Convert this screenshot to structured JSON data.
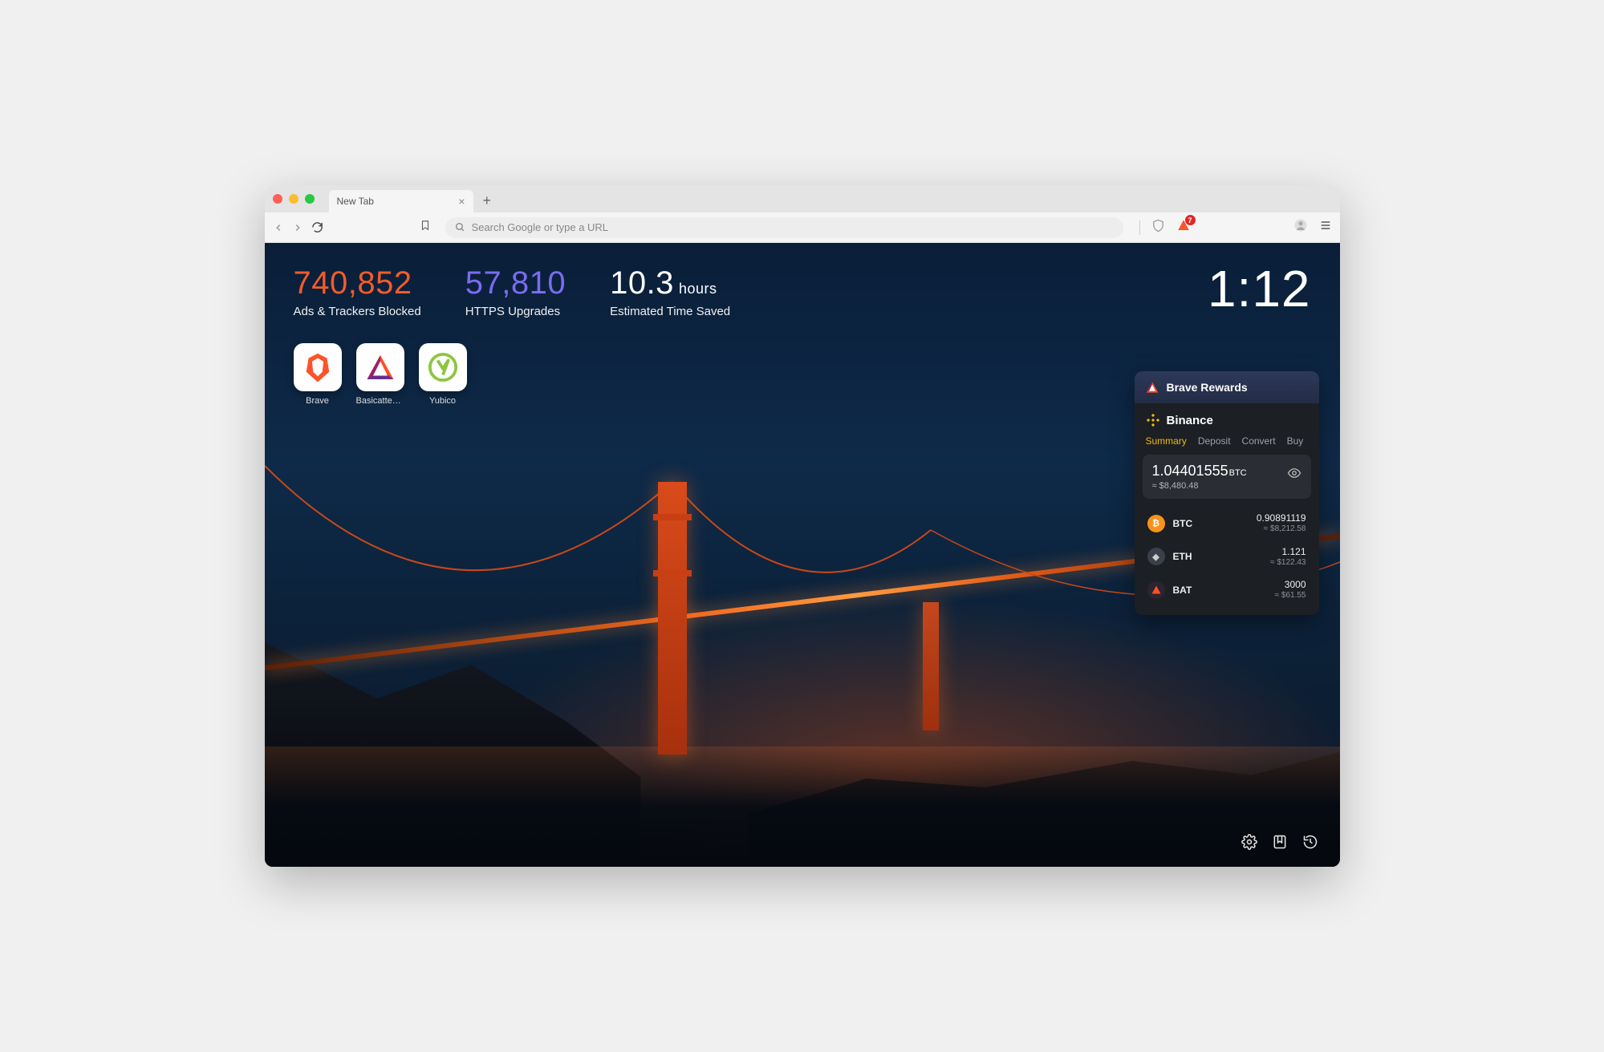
{
  "tab": {
    "title": "New Tab"
  },
  "omnibox": {
    "placeholder": "Search Google or type a URL"
  },
  "toolbar": {
    "ext_badge": "7"
  },
  "stats": {
    "blocked": {
      "value": "740,852",
      "label": "Ads & Trackers Blocked"
    },
    "https": {
      "value": "57,810",
      "label": "HTTPS Upgrades"
    },
    "time": {
      "value": "10.3",
      "unit": "hours",
      "label": "Estimated Time Saved"
    }
  },
  "clock": "1:12",
  "topsites": [
    {
      "name": "Brave"
    },
    {
      "name": "Basicatten…"
    },
    {
      "name": "Yubico"
    }
  ],
  "rewards": {
    "title": "Brave Rewards"
  },
  "binance": {
    "title": "Binance",
    "tabs": [
      "Summary",
      "Deposit",
      "Convert",
      "Buy"
    ],
    "balance": {
      "amount": "1.04401555",
      "currency": "BTC",
      "approx": "≈ $8,480.48"
    },
    "assets": [
      {
        "sym": "BTC",
        "amount": "0.90891119",
        "usd": "≈ $8,212.58",
        "color": "#f7931a"
      },
      {
        "sym": "ETH",
        "amount": "1.121",
        "usd": "≈ $122.43",
        "color": "#3b3f4a"
      },
      {
        "sym": "BAT",
        "amount": "3000",
        "usd": "≈ $61.55",
        "color": "#2b2431"
      }
    ]
  }
}
